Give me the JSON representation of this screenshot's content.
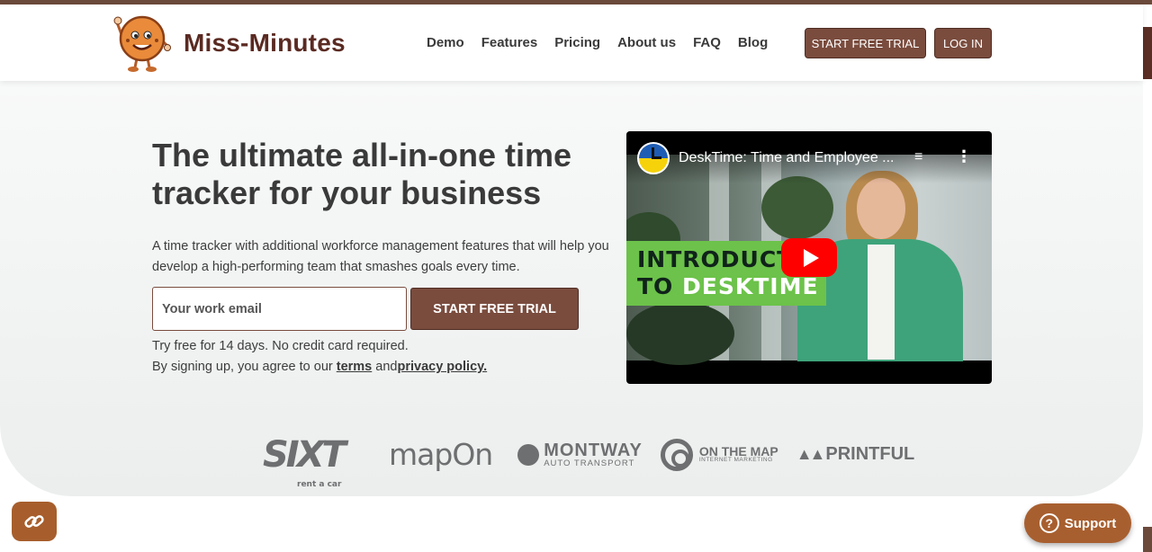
{
  "brand": {
    "name": "Miss-Minutes"
  },
  "nav": [
    {
      "label": "Demo"
    },
    {
      "label": "Features"
    },
    {
      "label": "Pricing"
    },
    {
      "label": "About us"
    },
    {
      "label": "FAQ"
    },
    {
      "label": "Blog"
    }
  ],
  "header": {
    "trial_label": "START FREE TRIAL",
    "login_label": "LOG IN"
  },
  "hero": {
    "title": "The ultimate all-in-one time tracker for your business",
    "subtitle": "A time tracker with additional workforce management features that will help you develop a high-performing team that smashes goals every time.",
    "email_placeholder": "Your work email",
    "trial_label": "START FREE TRIAL",
    "note1": "Try free for 14 days. No credit card required.",
    "note2_prefix": "By signing up, you agree to our ",
    "terms_label": "terms",
    "and_label": " and",
    "privacy_label": "privacy policy."
  },
  "video": {
    "title": "DeskTime: Time and Employee ...",
    "overlay_line1": "INTRODUCTI",
    "overlay_line2_a": "TO ",
    "overlay_line2_b": "DESKTIME"
  },
  "client_logos": {
    "sixt": "SIXT",
    "sixt_tag": "rent a car",
    "mapon": "mapOn",
    "montway": "MONTWAY",
    "montway_tag": "AUTO TRANSPORT",
    "onthemap": "ON THE MAP",
    "onthemap_tag": "INTERNET MARKETING",
    "printful": "PRINTFUL"
  },
  "support": {
    "label": "Support"
  },
  "colors": {
    "accent": "#7a4c3e",
    "brand_text": "#5a2a22",
    "support": "#a85f2f"
  }
}
